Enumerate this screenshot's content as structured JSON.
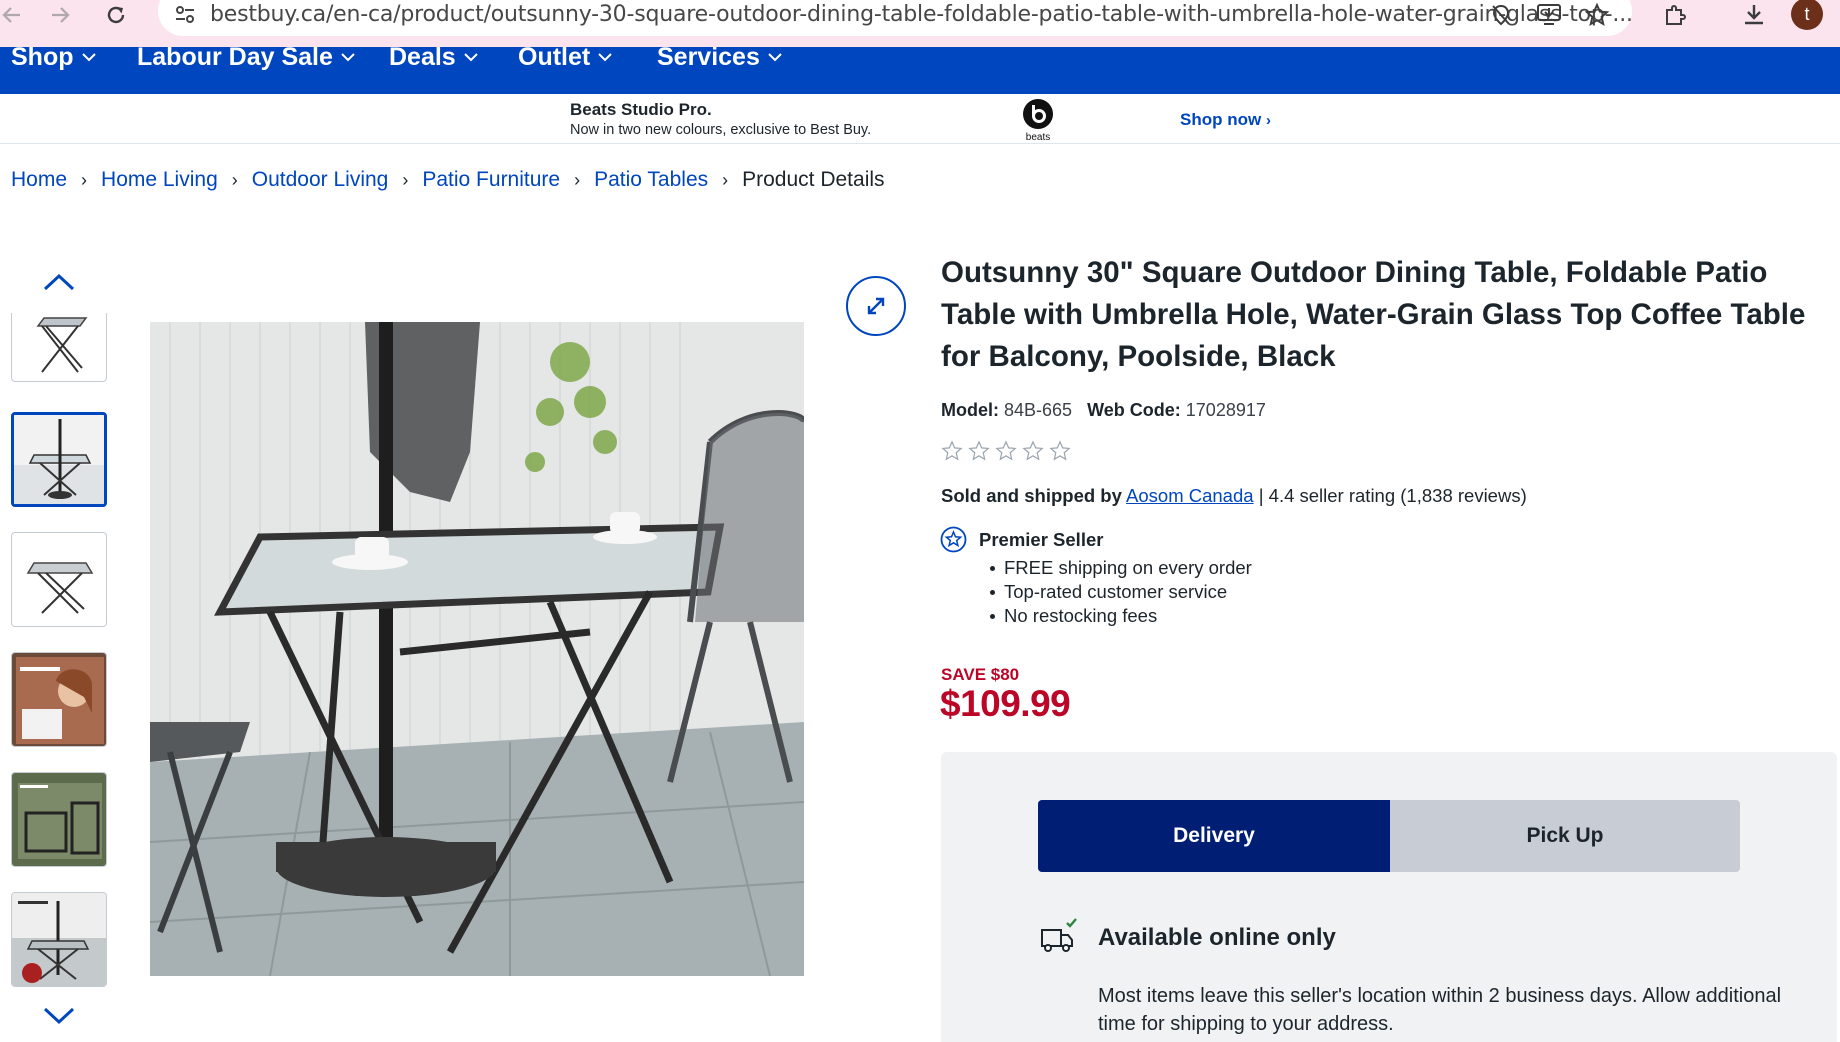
{
  "browser": {
    "url": "bestbuy.ca/en-ca/product/outsunny-30-square-outdoor-dining-table-foldable-patio-table-with-umbrella-hole-water-grain-glass-top-...",
    "avatar_letter": "t"
  },
  "nav": {
    "items": [
      {
        "label": "Shop"
      },
      {
        "label": "Labour Day Sale"
      },
      {
        "label": "Deals"
      },
      {
        "label": "Outlet"
      },
      {
        "label": "Services"
      }
    ]
  },
  "promo": {
    "title": "Beats Studio Pro.",
    "subtitle": "Now in two new colours, exclusive to Best Buy.",
    "logo_text": "beats",
    "cta": "Shop now"
  },
  "breadcrumb": {
    "items": [
      "Home",
      "Home Living",
      "Outdoor Living",
      "Patio Furniture",
      "Patio Tables"
    ],
    "current": "Product Details"
  },
  "product": {
    "title": "Outsunny 30\" Square Outdoor Dining Table, Foldable Patio Table with Umbrella Hole, Water-Grain Glass Top Coffee Table for Balcony, Poolside, Black",
    "model_label": "Model:",
    "model": "84B-665",
    "webcode_label": "Web Code:",
    "webcode": "17028917",
    "rating_stars": 0,
    "sold_by_prefix": "Sold and shipped by",
    "seller_name": "Aosom Canada",
    "seller_rating": "| 4.4 seller rating (1,838 reviews)",
    "premier_title": "Premier Seller",
    "benefits": [
      "FREE shipping on every order",
      "Top-rated customer service",
      "No restocking fees"
    ],
    "save": "SAVE $80",
    "price": "$109.99"
  },
  "fulfillment": {
    "delivery_label": "Delivery",
    "pickup_label": "Pick Up",
    "availability": "Available online only",
    "note": "Most items leave this seller's location within 2 business days. Allow additional time for shipping to your address."
  },
  "colors": {
    "brand_blue": "#0046be",
    "dark_blue": "#001e73",
    "sale_red": "#bb0628"
  }
}
